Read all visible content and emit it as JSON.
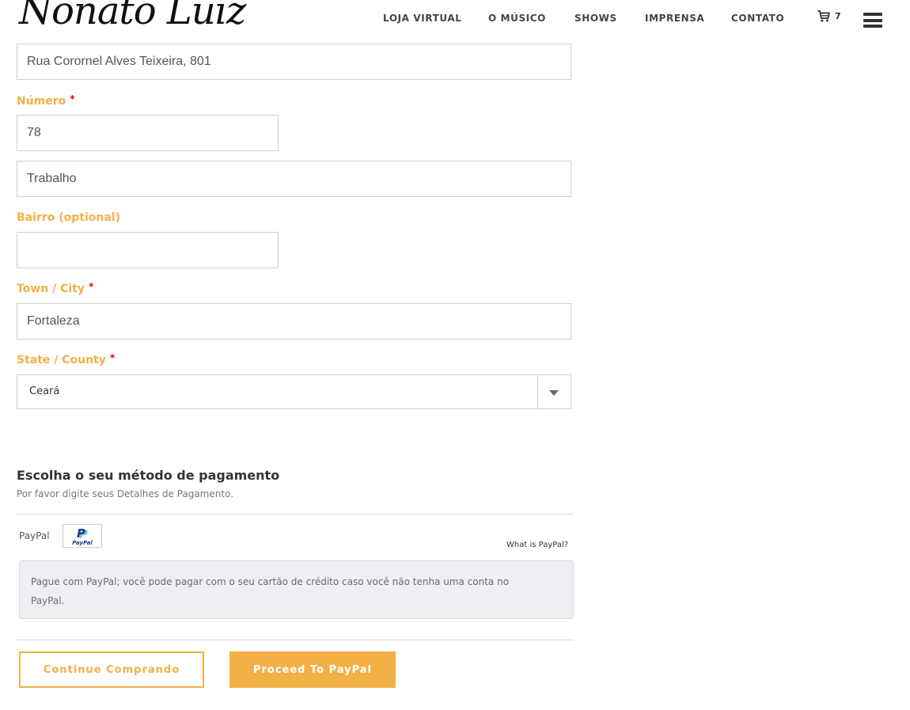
{
  "header": {
    "logo": "Nonato Luiz",
    "nav": [
      {
        "label": "LOJA VIRTUAL"
      },
      {
        "label": "O MÚSICO"
      },
      {
        "label": "SHOWS"
      },
      {
        "label": "IMPRENSA"
      },
      {
        "label": "CONTATO"
      }
    ],
    "cart_count": "7",
    "cart_icon": "cart-icon",
    "menu_icon": "hamburger-menu-icon"
  },
  "form": {
    "address_value": "Rua Corornel Alves Teixeira, 801",
    "numero_label": "Número",
    "numero_value": "78",
    "complemento_value": "Trabalho",
    "bairro_label": "Bairro (optional)",
    "bairro_value": "",
    "city_label": "Town / City",
    "city_value": "Fortaleza",
    "state_label": "State / County",
    "state_value": "Ceará",
    "required_mark": "*"
  },
  "payment": {
    "title": "Escolha o seu método de pagamento",
    "subtitle": "Por favor digite seus Detalhes de Pagamento.",
    "method_label": "PayPal",
    "logo_word": "PayPal",
    "logo_letter": "P",
    "what_is": "What is PayPal?",
    "description": "Pague com PayPal; você pode pagar com o seu cartão de crédito caso você não tenha uma conta no PayPal."
  },
  "actions": {
    "continue_label": "Continue Comprando",
    "proceed_label": "Proceed To PayPal"
  },
  "colors": {
    "accent": "#f3b046",
    "required": "#e00000",
    "text": "#333333",
    "panel_bg": "#efeff3"
  }
}
